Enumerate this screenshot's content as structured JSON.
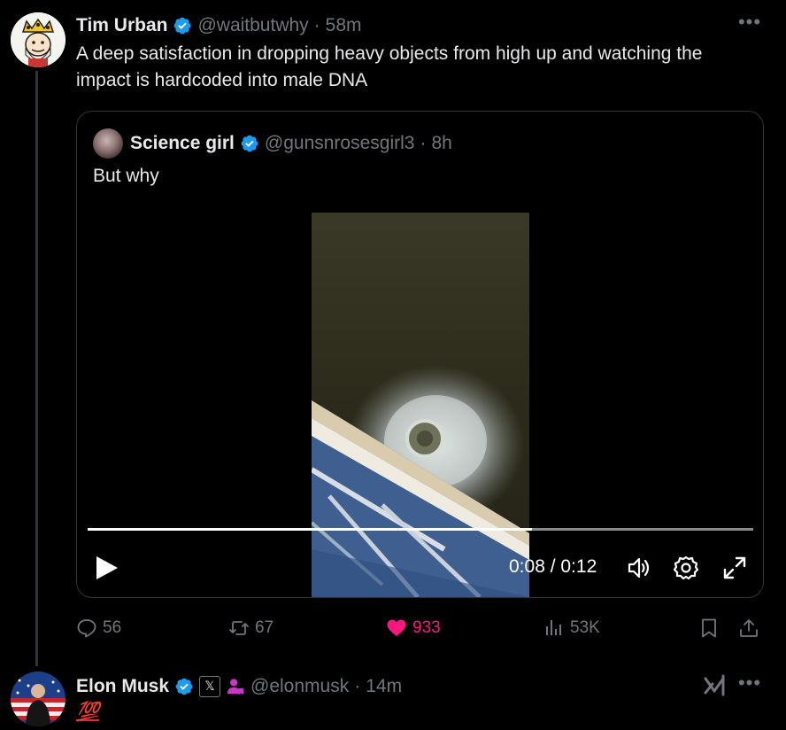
{
  "tweet": {
    "author_name": "Tim Urban",
    "author_handle": "@waitbutwhy",
    "separator": "·",
    "time": "58m",
    "text": "A deep satisfaction in dropping heavy objects from high up and watching the impact is hardcoded into male DNA",
    "more_label": "•••"
  },
  "quote": {
    "author_name": "Science girl",
    "author_handle": "@gunsnrosesgirl3",
    "separator": "·",
    "time": "8h",
    "text": "But why",
    "video": {
      "progress": 0.667,
      "time_readout": "0:08 / 0:12"
    }
  },
  "actions": {
    "replies": "56",
    "reposts": "67",
    "likes": "933",
    "views": "53K"
  },
  "reply": {
    "author_name": "Elon Musk",
    "author_handle": "@elonmusk",
    "separator": "·",
    "time": "14m",
    "text": "💯",
    "badge_label": "𝕏",
    "more_label": "•••"
  },
  "colors": {
    "verified": "#1d9bf0",
    "like": "#f91880",
    "muted": "#71767b",
    "text": "#e7e9ea",
    "affiliate_person": "#c936c8"
  }
}
